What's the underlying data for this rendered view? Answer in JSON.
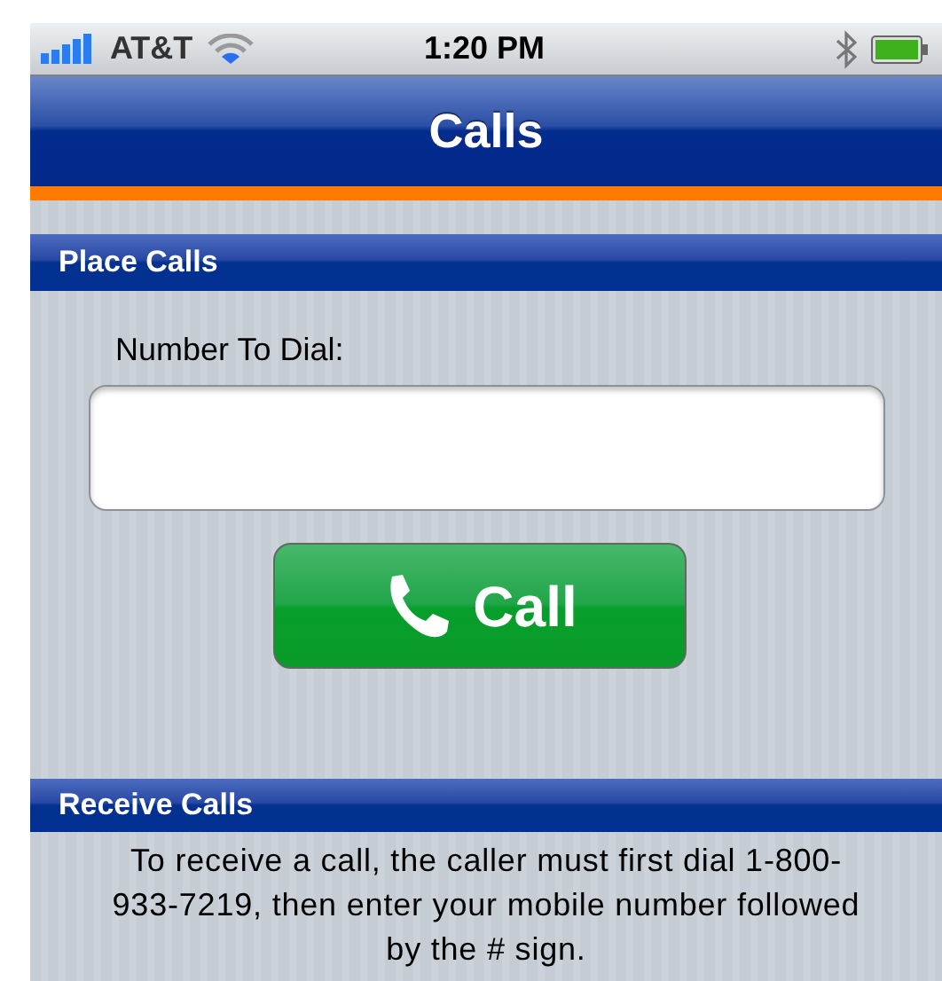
{
  "status_bar": {
    "carrier": "AT&T",
    "time": "1:20 PM"
  },
  "nav_bar": {
    "title": "Calls"
  },
  "place_calls": {
    "header": "Place Calls",
    "label": "Number To Dial:",
    "button": "Call"
  },
  "receive_calls": {
    "header": "Receive Calls",
    "text": "To receive a call, the caller must first dial 1-800-933-7219, then enter your mobile number followed by the # sign."
  }
}
